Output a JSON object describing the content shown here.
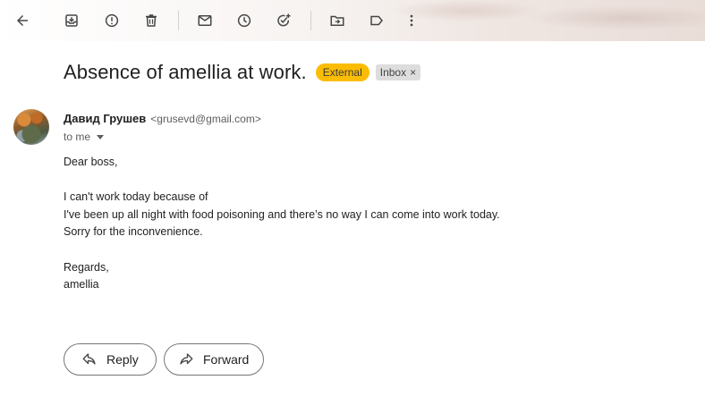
{
  "toolbar": {
    "icons": [
      "back-arrow-icon",
      "archive-icon",
      "report-spam-icon",
      "delete-icon",
      "mark-unread-icon",
      "snooze-icon",
      "add-to-tasks-icon",
      "move-to-icon",
      "label-icon",
      "more-options-icon"
    ]
  },
  "email": {
    "subject": "Absence of amellia at work.",
    "badge_external": "External",
    "badge_inbox": "Inbox",
    "badge_inbox_close": "×",
    "sender_name": "Давид Грушев",
    "sender_email": "<grusevd@gmail.com>",
    "recipient": "to me",
    "body_lines": [
      "Dear boss,",
      "",
      "I can't work today because of",
      "I've been up all night with food poisoning and there’s no way I can come into work today.",
      "Sorry for the inconvenience.",
      "",
      "Regards,",
      "amellia"
    ]
  },
  "actions": {
    "reply_label": "Reply",
    "forward_label": "Forward"
  },
  "colors": {
    "external_badge": "#fbbc04",
    "inbox_badge": "#dddddd",
    "icon": "#444746"
  }
}
